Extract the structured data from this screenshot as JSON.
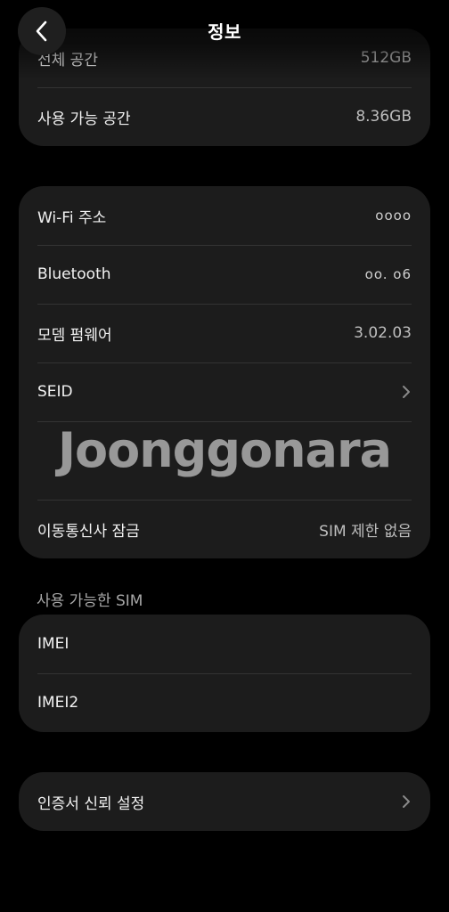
{
  "header": {
    "title": "정보",
    "back_icon": "chevron-left-icon"
  },
  "storage_card": {
    "rows": [
      {
        "label": "전체 공간",
        "value": "512GB"
      },
      {
        "label": "사용 가능 공간",
        "value": "8.36GB"
      }
    ]
  },
  "network_card": {
    "rows": [
      {
        "label": "Wi-Fi 주소",
        "value": "oooo"
      },
      {
        "label": "Bluetooth",
        "value": "oo. o6"
      },
      {
        "label": "모뎀 펌웨어",
        "value": "3.02.03"
      },
      {
        "label": "SEID",
        "value": ""
      },
      {
        "label": "",
        "value": ""
      },
      {
        "label": "이동통신사 잠금",
        "value": "SIM 제한 없음"
      }
    ]
  },
  "sim_section": {
    "title": "사용 가능한 SIM",
    "rows": [
      {
        "label": "IMEI",
        "value": ""
      },
      {
        "label": "IMEI2",
        "value": ""
      }
    ]
  },
  "cert_card": {
    "label": "인증서 신뢰 설정"
  },
  "watermark": {
    "text": "Joonggonara"
  },
  "colors": {
    "background": "#000000",
    "card": "#1c1c1c",
    "divider": "#333333",
    "value_text": "#bdbdbd",
    "section_title": "#a6a6a6"
  }
}
